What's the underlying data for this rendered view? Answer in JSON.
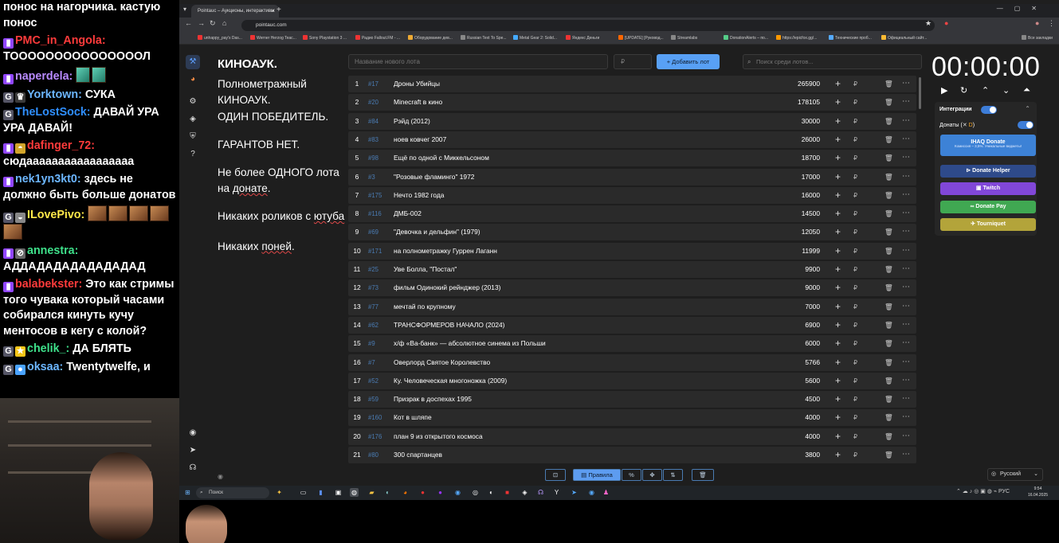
{
  "chat": {
    "messages": [
      {
        "user": "",
        "user_color": "#ffffff",
        "text": "понос на нагорчика. кастую понос",
        "badges": []
      },
      {
        "user": "PMC_in_Angola:",
        "user_color": "#ff3b3b",
        "text": "ТОООООООООООООООЛ",
        "badges": [
          "twitch"
        ]
      },
      {
        "user": "naperdela:",
        "user_color": "#b98bff",
        "text": "",
        "badges": [
          "twitch"
        ],
        "emotes": [
          "green",
          "green"
        ]
      },
      {
        "user": "Yorktown:",
        "user_color": "#6cb6ff",
        "text": "СУКА",
        "badges": [
          "g",
          "crown"
        ]
      },
      {
        "user": "TheLostSock:",
        "user_color": "#2f8fff",
        "text": "ДАВАЙ УРА УРА ДАВАЙ!",
        "badges": [
          "g"
        ]
      },
      {
        "user": "dafinger_72:",
        "user_color": "#ff3b3b",
        "text": "сюдааааааааааааааааа",
        "badges": [
          "twitch",
          "hat"
        ]
      },
      {
        "user": "nek1yn3kt0:",
        "user_color": "#6cb6ff",
        "text": "здесь не должно быть больше донатов",
        "badges": [
          "twitch"
        ]
      },
      {
        "user": "ILovePivo:",
        "user_color": "#ffe94a",
        "text": "",
        "badges": [
          "g",
          "lock"
        ],
        "emotes": [
          "brown",
          "brown",
          "brown",
          "brown",
          "brown"
        ]
      },
      {
        "user": "annestra:",
        "user_color": "#3ee08a",
        "text": "АДДАДАДАДАДАДАДАД",
        "badges": [
          "twitch",
          "no"
        ]
      },
      {
        "user": "balabekster:",
        "user_color": "#ff3b3b",
        "text": "Это как стримы того чувака который часами собирался кинуть кучу ментосов в кегу с колой?",
        "badges": [
          "twitch"
        ]
      },
      {
        "user": "chelik_:",
        "user_color": "#3ee08a",
        "text": "ДА БЛЯТЬ",
        "badges": [
          "g",
          "star"
        ]
      },
      {
        "user": "oksaa:",
        "user_color": "#6cb6ff",
        "text": "Twentytwelfe, и",
        "badges": [
          "g",
          "apple"
        ]
      }
    ]
  },
  "browser": {
    "tab_title": "Pointauc – Аукционы, интерактивы",
    "url": "pointauc.com",
    "bookmarks": [
      "unhappy_pay's Das...",
      "Werner Herzog Teac...",
      "Sony Playstation 3 ...",
      "Радио Fallout.FM - ...",
      "Оборудование дев...",
      "Russian Text To Spe...",
      "Metal Gear 2: Solid...",
      "Яндекс Деньги",
      "[UPDATE] [Руковод...",
      "Streamlabs",
      "DonationAlerts – по...",
      "https://epicfox.gg/...",
      "Технические проб...",
      "Официальный сайт...",
      "Все закладки"
    ]
  },
  "rules": {
    "title": "КИНОАУК.",
    "line1": "Полнометражный КИНОАУК.",
    "line2": "ОДИН ПОБЕДИТЕЛЬ.",
    "line3": "ГАРАНТОВ НЕТ.",
    "line4a": "Не более ОДНОГО лота на ",
    "line4b": "донате",
    "line4c": ".",
    "line5a": "Никаких роликов с ",
    "line5b": "ютуба",
    "line6a": "Никаких ",
    "line6b": "поней",
    "line6c": "."
  },
  "form": {
    "lot_placeholder": "Название нового лота",
    "amount_placeholder": "₽",
    "add_button": "Добавить лот",
    "search_placeholder": "Поиск среди лотов..."
  },
  "lots": [
    {
      "n": "1",
      "id": "#17",
      "name": "Дроны Убийцы",
      "amount": "265900"
    },
    {
      "n": "2",
      "id": "#20",
      "name": "Minecraft в кино",
      "amount": "178105"
    },
    {
      "n": "3",
      "id": "#84",
      "name": "Рэйд (2012)",
      "amount": "30000"
    },
    {
      "n": "4",
      "id": "#83",
      "name": "ноев ковчег 2007",
      "amount": "26000"
    },
    {
      "n": "5",
      "id": "#98",
      "name": "Ещё по одной с Миккельсоном",
      "amount": "18700"
    },
    {
      "n": "6",
      "id": "#3",
      "name": "\"Розовые фламинго\" 1972",
      "amount": "17000"
    },
    {
      "n": "7",
      "id": "#175",
      "name": " Нечто 1982 года",
      "amount": "16000"
    },
    {
      "n": "8",
      "id": "#116",
      "name": "ДМБ-002",
      "amount": "14500"
    },
    {
      "n": "9",
      "id": "#69",
      "name": "\"Девочка и дельфин\" (1979)",
      "amount": "12050"
    },
    {
      "n": "10",
      "id": "#171",
      "name": "на полнометражку Гуррен Лаганн",
      "amount": "11999"
    },
    {
      "n": "11",
      "id": "#25",
      "name": "Уве Болла, \"Постал\"",
      "amount": "9900"
    },
    {
      "n": "12",
      "id": "#73",
      "name": "фильм Одинокий рейнджер (2013)",
      "amount": "9000"
    },
    {
      "n": "13",
      "id": "#77",
      "name": "мечтай по крупному",
      "amount": "7000"
    },
    {
      "n": "14",
      "id": "#62",
      "name": "ТРАНСФОРМЕРОВ НАЧАЛО (2024)",
      "amount": "6900"
    },
    {
      "n": "15",
      "id": "#9",
      "name": "х/ф «Ва-банк» — абсолютное синема из Польши",
      "amount": "6000"
    },
    {
      "n": "16",
      "id": "#7",
      "name": "Оверлорд Святое Королевство",
      "amount": "5766"
    },
    {
      "n": "17",
      "id": "#52",
      "name": "Ку. Человеческая многоножка (2009)",
      "amount": "5600"
    },
    {
      "n": "18",
      "id": "#59",
      "name": "Призрак в доспехах 1995",
      "amount": "4500"
    },
    {
      "n": "19",
      "id": "#160",
      "name": " Кот в шляпе",
      "amount": "4000"
    },
    {
      "n": "20",
      "id": "#176",
      "name": " план 9 из открытого космоса",
      "amount": "4000"
    },
    {
      "n": "21",
      "id": "#80",
      "name": "300 спартанцев",
      "amount": "3800"
    }
  ],
  "lot_currency": "₽",
  "timer": "00:00:00",
  "integrations": {
    "title": "Интеграции",
    "donations_label": "Донаты (",
    "donations_label_end": ")",
    "ihaq_title": "IHAQ Donate",
    "ihaq_sub": "Комиссия – 3,5%. Уникальные виджеты!",
    "donate_helper": "Donate Helper",
    "twitch": "Twitch",
    "donate_pay": "Donate Pay",
    "tourniquet": "Tourniquet",
    "colors": {
      "ihaq": "#3d82d6",
      "helper": "#2e4a8a",
      "twitch": "#8147d8",
      "donatepay": "#40a852",
      "tourniquet": "#b3a43a"
    }
  },
  "bottom": {
    "rules_button": "Правила"
  },
  "language": "Русский",
  "taskbar": {
    "search": "Поиск",
    "time": "9:54",
    "date": "16.04.2025",
    "lang": "РУС"
  }
}
